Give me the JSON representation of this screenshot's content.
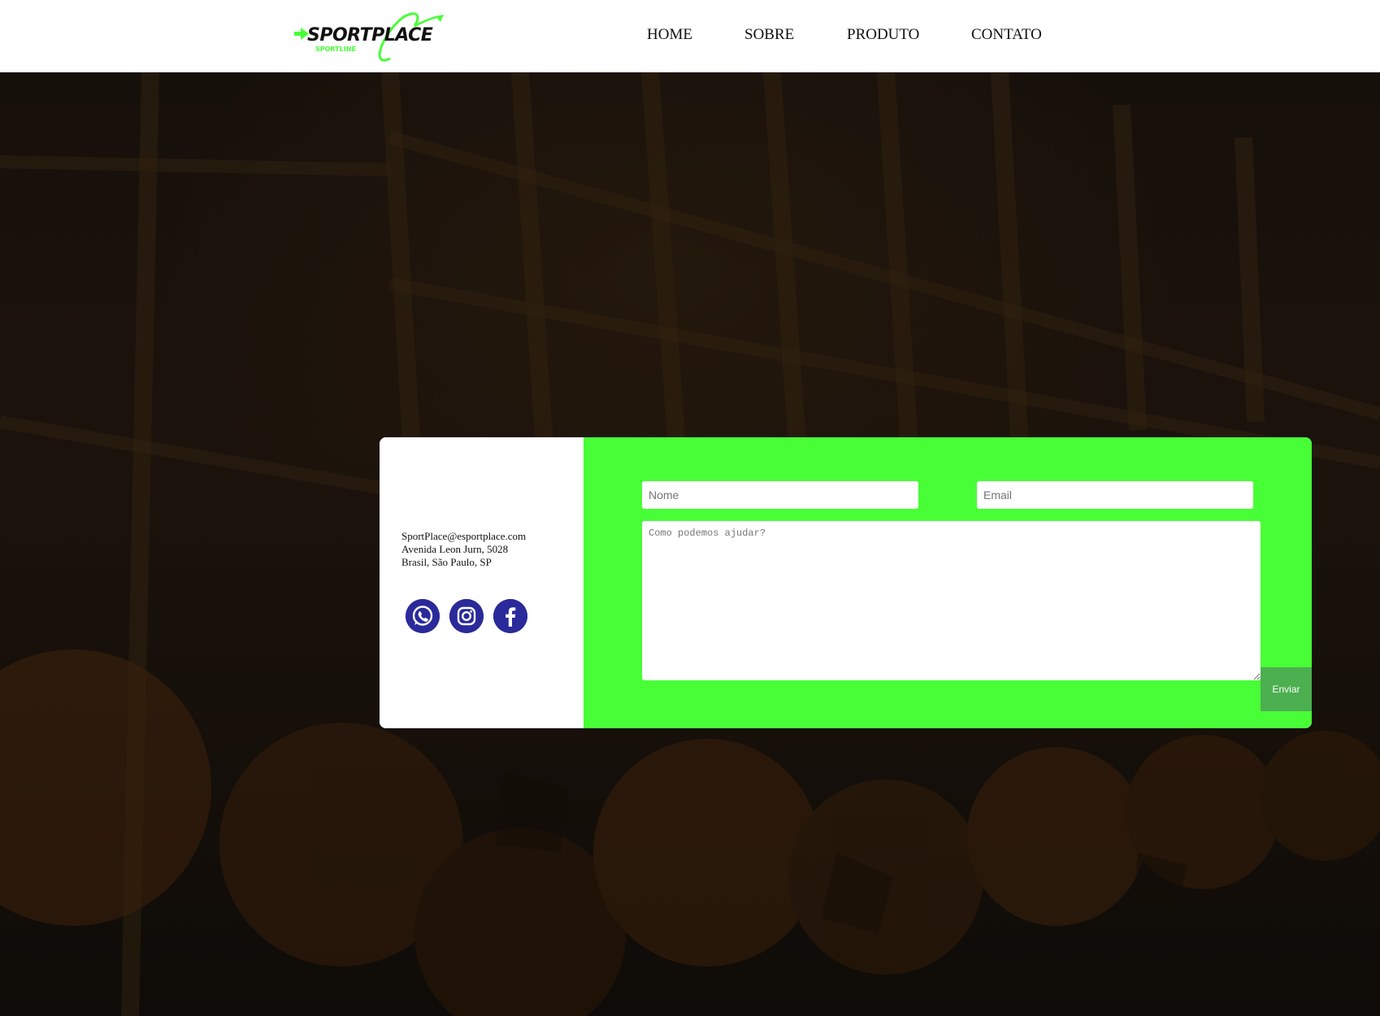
{
  "brand": {
    "name": "SPORTPLACE",
    "tagline": "SPORTLINE",
    "accent": "#48fe36"
  },
  "nav": {
    "items": [
      {
        "label": "HOME"
      },
      {
        "label": "SOBRE"
      },
      {
        "label": "PRODUTO"
      },
      {
        "label": "CONTATO"
      }
    ]
  },
  "contact": {
    "email": "SportPlace@esportplace.com",
    "address_line1": "Avenida Leon Jurn, 5028",
    "address_line2": "Brasil, São Paulo, SP",
    "socials": [
      {
        "icon": "whatsapp-icon"
      },
      {
        "icon": "instagram-icon"
      },
      {
        "icon": "facebook-icon"
      }
    ]
  },
  "form": {
    "name_placeholder": "Nome",
    "email_placeholder": "Email",
    "message_placeholder": "Como podemos ajudar?",
    "submit_label": "Enviar",
    "background": "#48fe36",
    "button_color": "#4caf50"
  },
  "social_color": "#2a2a9a"
}
